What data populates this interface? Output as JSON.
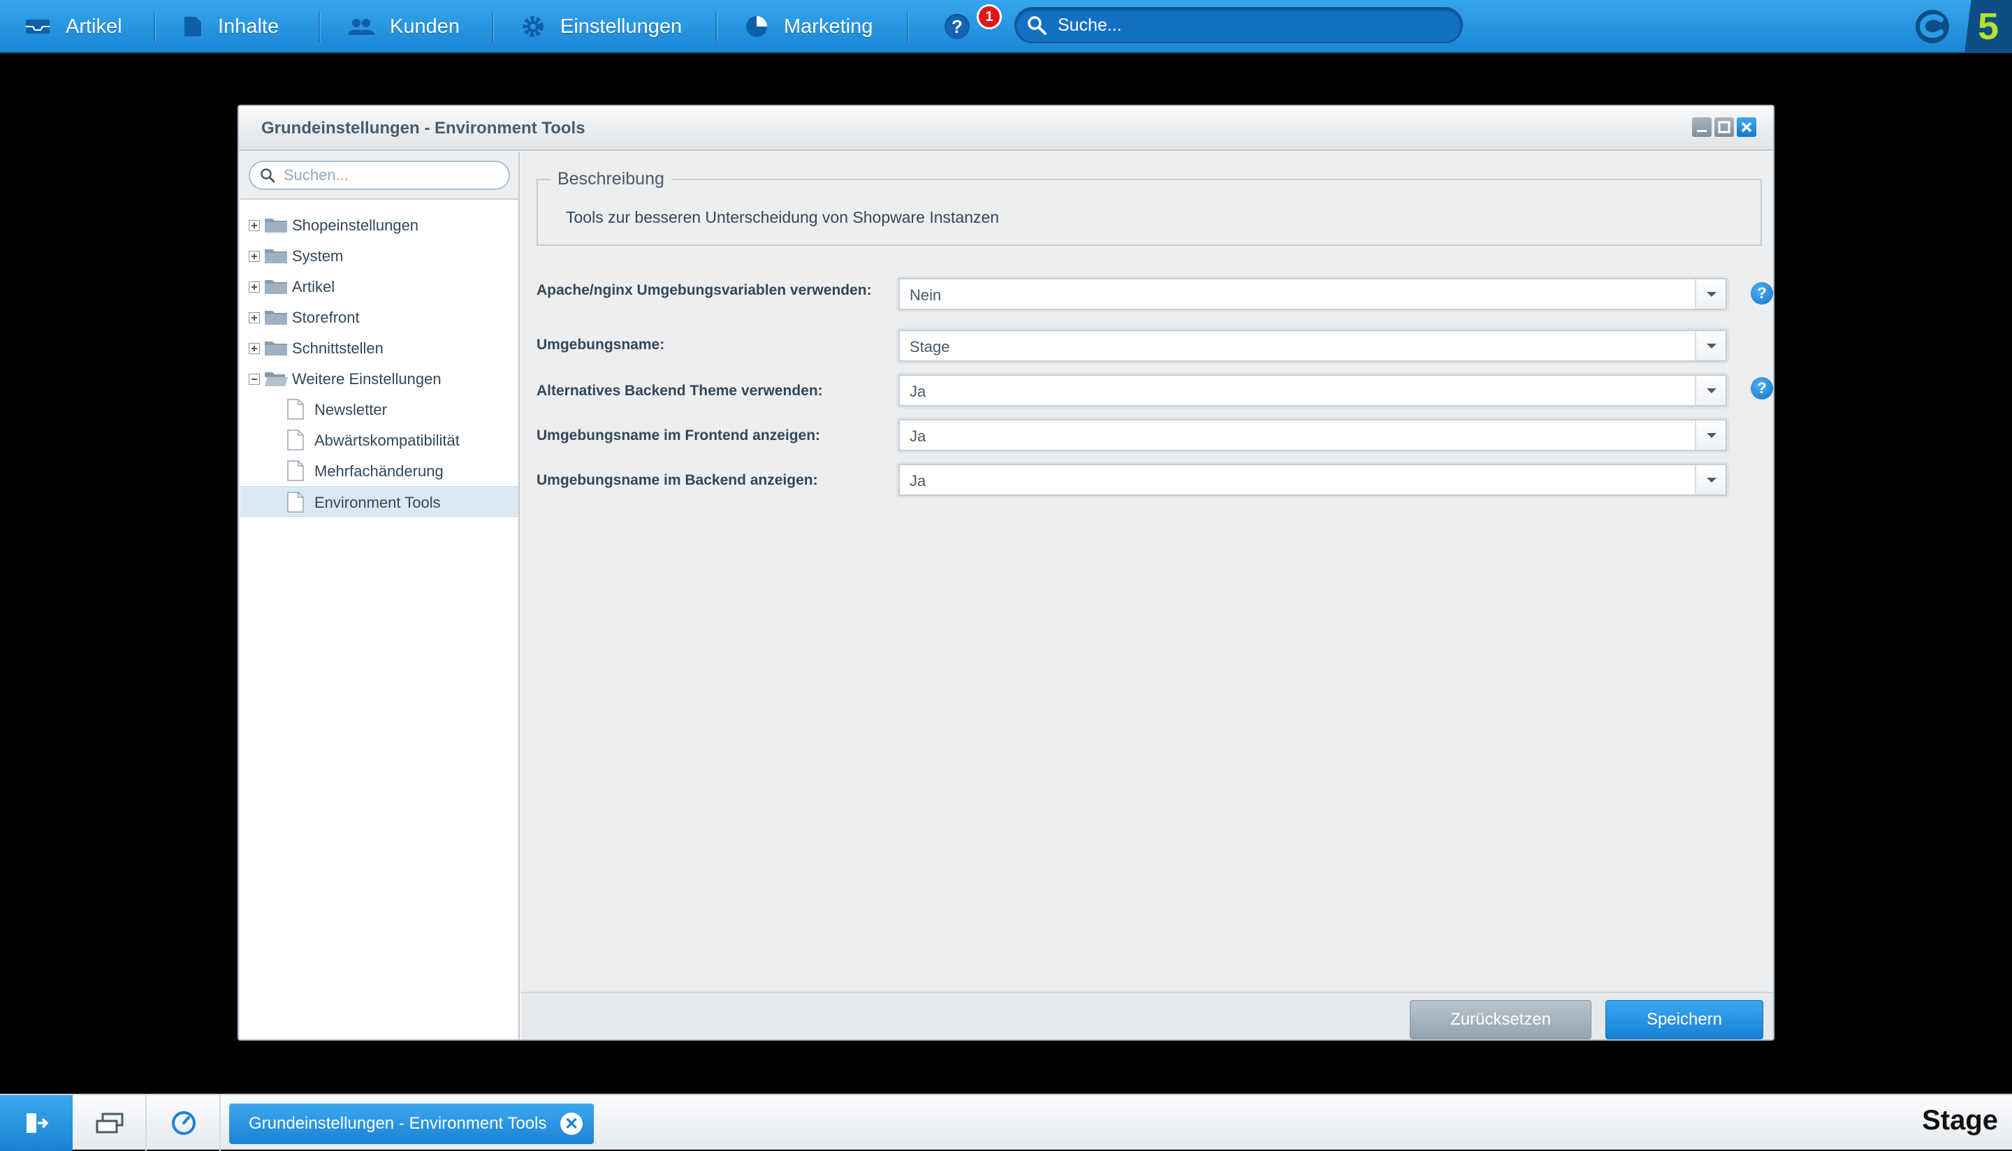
{
  "topbar": {
    "menu": [
      {
        "label": "Artikel",
        "icon": "inbox-icon"
      },
      {
        "label": "Inhalte",
        "icon": "document-icon"
      },
      {
        "label": "Kunden",
        "icon": "users-icon"
      },
      {
        "label": "Einstellungen",
        "icon": "gear-icon"
      },
      {
        "label": "Marketing",
        "icon": "pie-chart-icon"
      }
    ],
    "help_badge_count": "1",
    "search_placeholder": "Suche...",
    "help_glyph": "?"
  },
  "window": {
    "title": "Grundeinstellungen - Environment Tools",
    "tree_search_placeholder": "Suchen...",
    "tree": [
      {
        "label": "Shopeinstellungen",
        "expanded": false
      },
      {
        "label": "System",
        "expanded": false
      },
      {
        "label": "Artikel",
        "expanded": false
      },
      {
        "label": "Storefront",
        "expanded": false
      },
      {
        "label": "Schnittstellen",
        "expanded": false
      },
      {
        "label": "Weitere Einstellungen",
        "expanded": true
      }
    ],
    "tree_children": [
      {
        "label": "Newsletter"
      },
      {
        "label": "Abwärtskompatibilität"
      },
      {
        "label": "Mehrfachänderung"
      },
      {
        "label": "Environment Tools",
        "selected": true
      }
    ],
    "description": {
      "legend": "Beschreibung",
      "text": "Tools zur besseren Unterscheidung von Shopware Instanzen"
    },
    "fields": [
      {
        "label": "Apache/nginx Umgebungsvariablen verwenden:",
        "value": "Nein",
        "help": true
      },
      {
        "label": "Umgebungsname:",
        "value": "Stage",
        "help": false
      },
      {
        "label": "Alternatives Backend Theme verwenden:",
        "value": "Ja",
        "help": true
      },
      {
        "label": "Umgebungsname im Frontend anzeigen:",
        "value": "Ja",
        "help": false
      },
      {
        "label": "Umgebungsname im Backend anzeigen:",
        "value": "Ja",
        "help": false
      }
    ],
    "buttons": {
      "reset": "Zurücksetzen",
      "save": "Speichern"
    }
  },
  "taskbar": {
    "task_label": "Grundeinstellungen - Environment Tools",
    "environment_label": "Stage"
  },
  "colors": {
    "accent": "#1a82d4",
    "badge": "#e2161d",
    "brand_green": "#b6e22a"
  }
}
